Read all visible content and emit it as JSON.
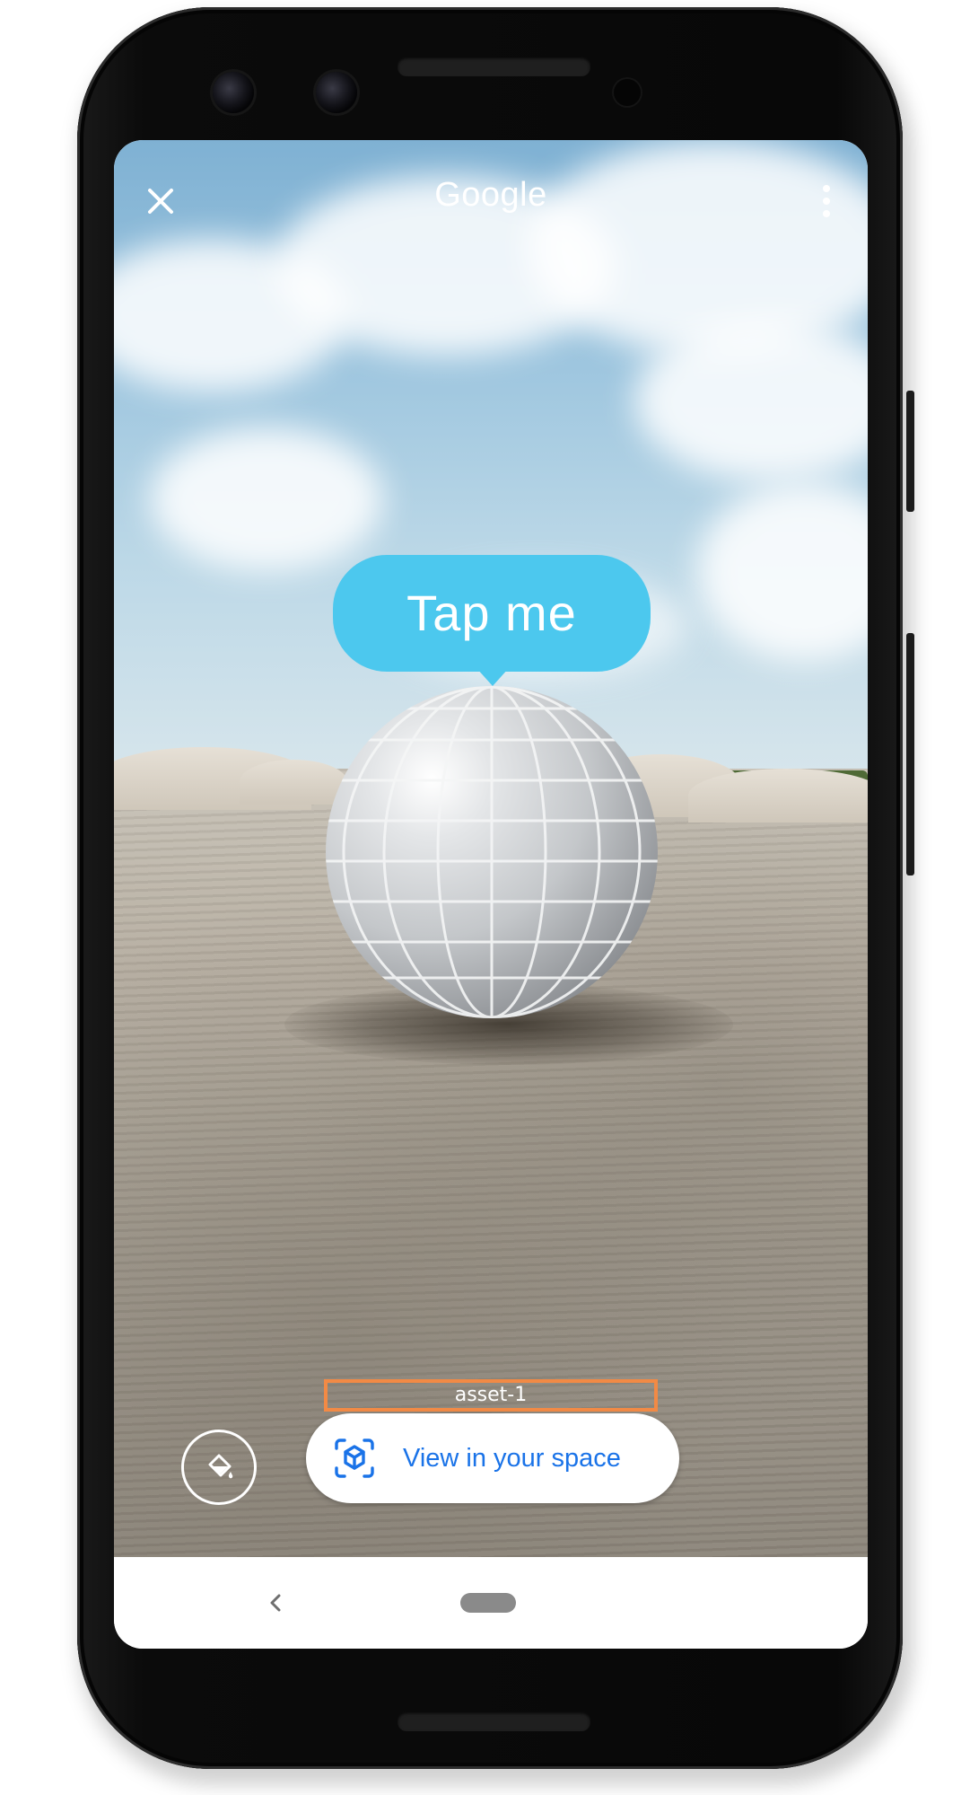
{
  "header": {
    "title": "Google",
    "close_icon": "close-icon",
    "menu_icon": "more-vert-icon"
  },
  "scene": {
    "tooltip_text": "Tap me",
    "tooltip_color": "#4cc8ee"
  },
  "annotation": {
    "label": "asset-1",
    "border_color": "#f28a45"
  },
  "controls": {
    "environment_icon": "paint-bucket-icon",
    "ar_button_label": "View in your space",
    "ar_icon": "ar-cube-icon",
    "ar_button_color": "#1a73e8"
  },
  "navbar": {
    "back_icon": "chevron-left-icon",
    "home_icon": "home-pill-icon"
  }
}
